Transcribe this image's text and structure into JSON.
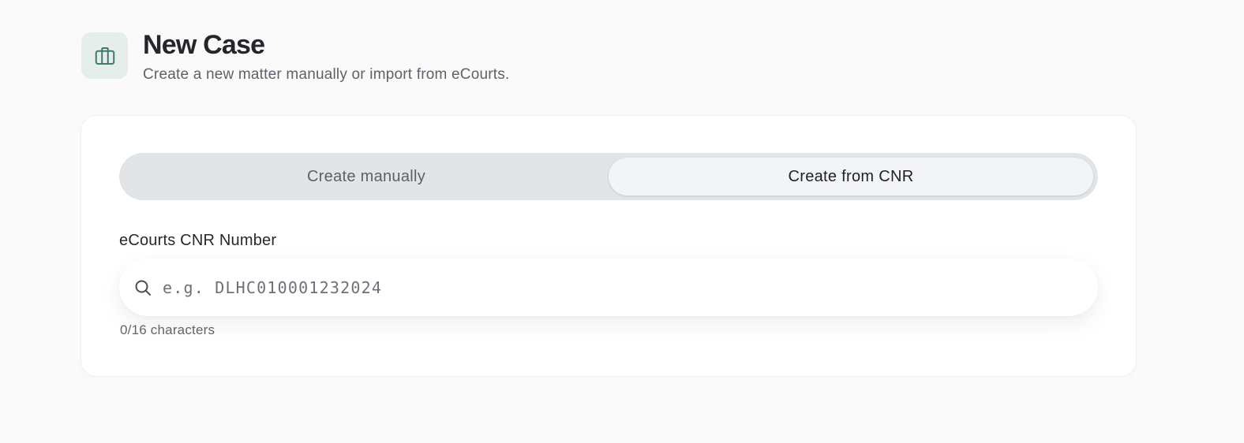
{
  "header": {
    "icon": "briefcase-icon",
    "title": "New Case",
    "subtitle": "Create a new matter manually or import from eCourts."
  },
  "tabs": [
    {
      "label": "Create manually",
      "active": false
    },
    {
      "label": "Create from CNR",
      "active": true
    }
  ],
  "form": {
    "cnr_label": "eCourts CNR Number",
    "cnr_value": "",
    "cnr_placeholder": "e.g. DLHC010001232024",
    "search_icon": "search-icon",
    "char_count": "0/16 characters"
  },
  "colors": {
    "accent": "#3d7a6e",
    "icon_bg": "#e6eeec",
    "tab_track": "#e2e5e8",
    "tab_active": "#f3f4f6"
  }
}
